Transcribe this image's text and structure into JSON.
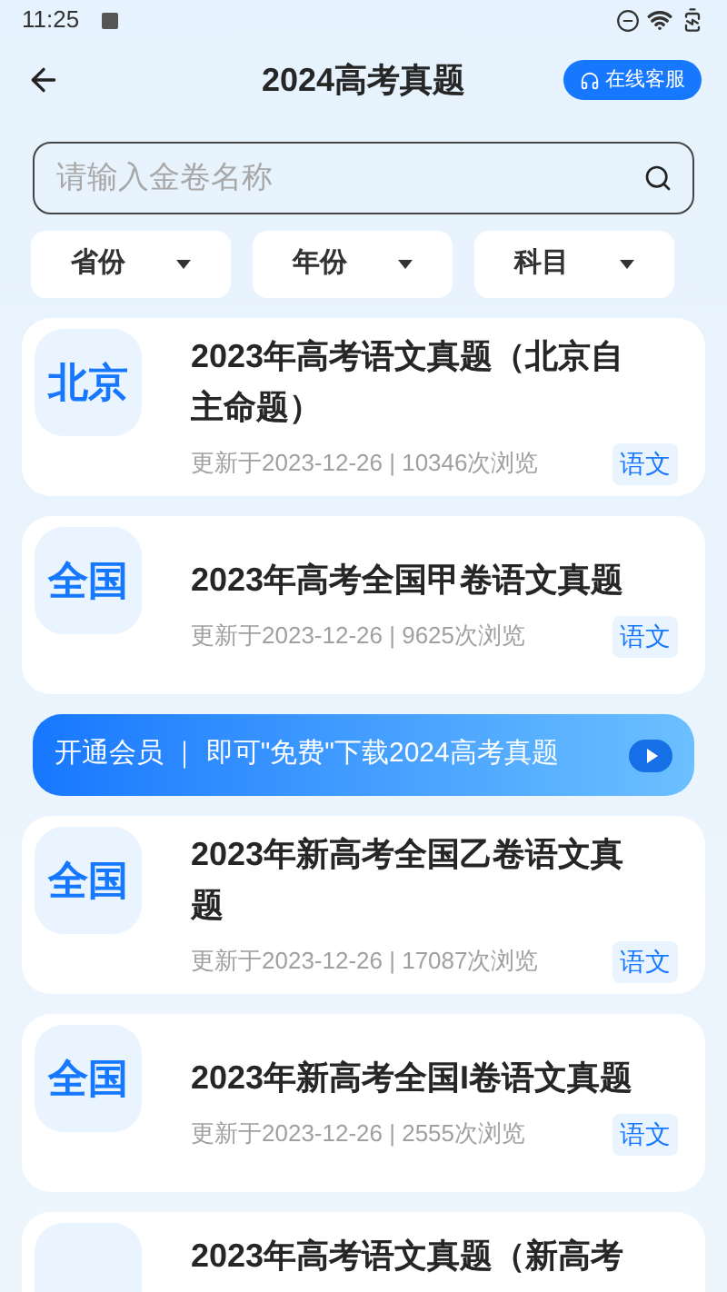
{
  "status_bar": {
    "time": "11:25"
  },
  "header": {
    "title": "2024高考真题",
    "service_button": "在线客服"
  },
  "search": {
    "placeholder": "请输入金卷名称"
  },
  "filters": [
    {
      "label": "省份"
    },
    {
      "label": "年份"
    },
    {
      "label": "科目"
    }
  ],
  "list": [
    {
      "kind": "paper",
      "region": "北京",
      "title": "2023年高考语文真题（北京自主命题）",
      "meta": "更新于2023-12-26 | 10346次浏览",
      "subject": "语文"
    },
    {
      "kind": "paper",
      "region": "全国",
      "title": "2023年高考全国甲卷语文真题",
      "meta": "更新于2023-12-26 | 9625次浏览",
      "subject": "语文"
    },
    {
      "kind": "banner",
      "text": "开通会员 ｜ 即可\"免费\"下载2024高考真题"
    },
    {
      "kind": "paper",
      "region": "全国",
      "title": "2023年新高考全国乙卷语文真题",
      "meta": "更新于2023-12-26 | 17087次浏览",
      "subject": "语文"
    },
    {
      "kind": "paper",
      "region": "全国",
      "title": "2023年新高考全国I卷语文真题",
      "meta": "更新于2023-12-26 | 2555次浏览",
      "subject": "语文"
    },
    {
      "kind": "paper",
      "title": "2023年高考语文真题（新高考"
    }
  ]
}
